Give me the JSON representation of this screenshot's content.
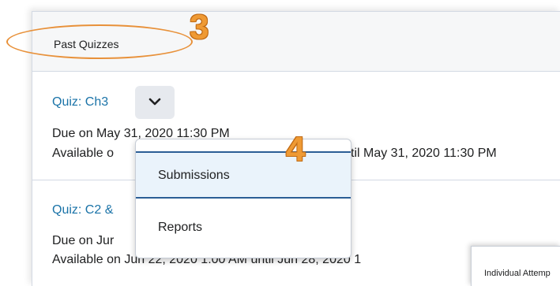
{
  "section": {
    "title": "Past Quizzes"
  },
  "annotations": {
    "step_a": "3",
    "step_b": "4"
  },
  "quizzes": [
    {
      "title": "Quiz: Ch3",
      "due": "Due on May 31, 2020 11:30 PM",
      "available_left": "Available o",
      "available_right": "til May 31, 2020 11:30 PM"
    },
    {
      "title": "Quiz: C2 &",
      "due": "Due on Jur",
      "available": "Available on Jun 22, 2020 1:00 AM until Jun 28, 2020 1"
    }
  ],
  "context_menu": {
    "items": [
      "Submissions",
      "Reports"
    ]
  },
  "overlay": {
    "label": "Individual Attemp"
  },
  "icons": {
    "menu_toggle": "chevron-down-icon"
  },
  "colors": {
    "annotation": "#ef9a34",
    "link": "#1a73a8",
    "active_border": "#2b5e95"
  }
}
